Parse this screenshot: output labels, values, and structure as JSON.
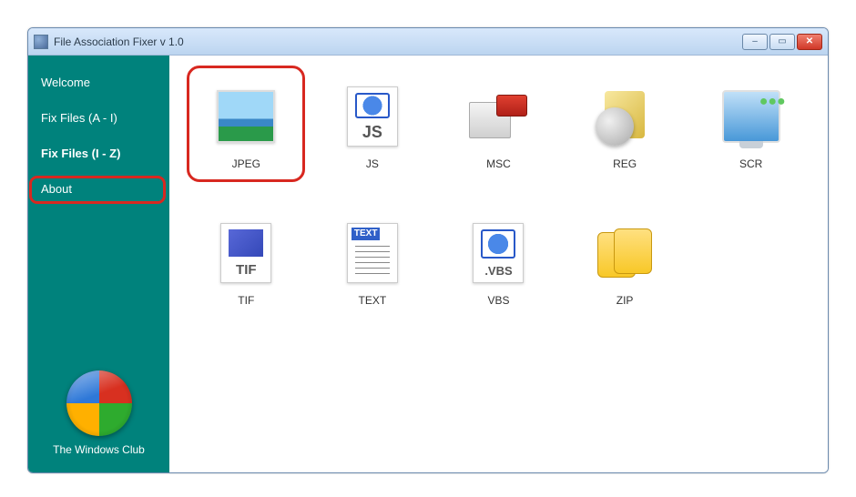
{
  "window": {
    "title": "File Association Fixer v 1.0"
  },
  "sidebar": {
    "items": [
      {
        "label": "Welcome"
      },
      {
        "label": "Fix Files (A - I)"
      },
      {
        "label": "Fix Files (I - Z)"
      },
      {
        "label": "About"
      }
    ],
    "footer": "The Windows Club"
  },
  "content": {
    "items": [
      {
        "label": "JPEG",
        "icon": "jpeg"
      },
      {
        "label": "JS",
        "icon": "js"
      },
      {
        "label": "MSC",
        "icon": "msc"
      },
      {
        "label": "REG",
        "icon": "reg"
      },
      {
        "label": "SCR",
        "icon": "scr"
      },
      {
        "label": "TIF",
        "icon": "tif"
      },
      {
        "label": "TEXT",
        "icon": "text"
      },
      {
        "label": "VBS",
        "icon": "vbs"
      },
      {
        "label": "ZIP",
        "icon": "zip"
      }
    ]
  }
}
